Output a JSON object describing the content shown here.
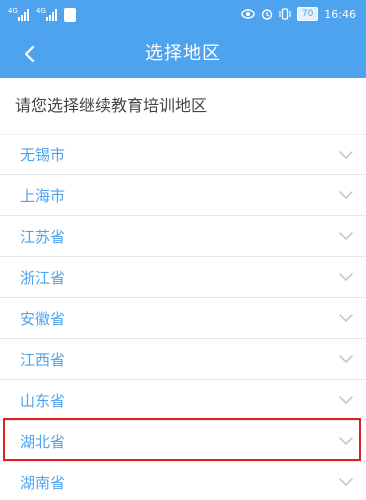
{
  "status_bar": {
    "left_signals": [
      "4G",
      "4G"
    ],
    "battery": "70",
    "time": "16:46",
    "icons": [
      "eye-icon",
      "alarm-icon",
      "vibrate-icon"
    ]
  },
  "header": {
    "title": "选择地区",
    "back_icon": "chevron-left-icon"
  },
  "prompt": "请您选择继续教育培训地区",
  "regions": [
    {
      "label": "无锡市"
    },
    {
      "label": "上海市"
    },
    {
      "label": "江苏省"
    },
    {
      "label": "浙江省"
    },
    {
      "label": "安徽省"
    },
    {
      "label": "江西省"
    },
    {
      "label": "山东省"
    },
    {
      "label": "湖北省",
      "highlighted": true
    },
    {
      "label": "湖南省"
    }
  ],
  "colors": {
    "primary": "#4ea3ee",
    "highlight_border": "#e02020",
    "chevron": "#c8c8c8"
  }
}
